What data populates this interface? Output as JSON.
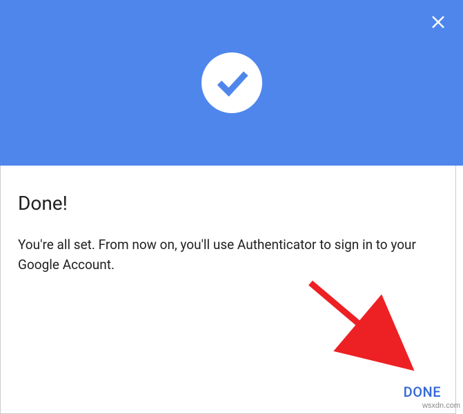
{
  "header": {
    "icon": "checkmark-icon",
    "close_icon": "close-icon"
  },
  "content": {
    "title": "Done!",
    "description": "You're all set. From now on, you'll use Authenticator to sign in to your Google Account."
  },
  "footer": {
    "done_label": "DONE"
  },
  "watermark": "wsxdn.com",
  "colors": {
    "header_bg": "#4f86ec",
    "accent": "#3367d6",
    "arrow": "#ed2024"
  }
}
